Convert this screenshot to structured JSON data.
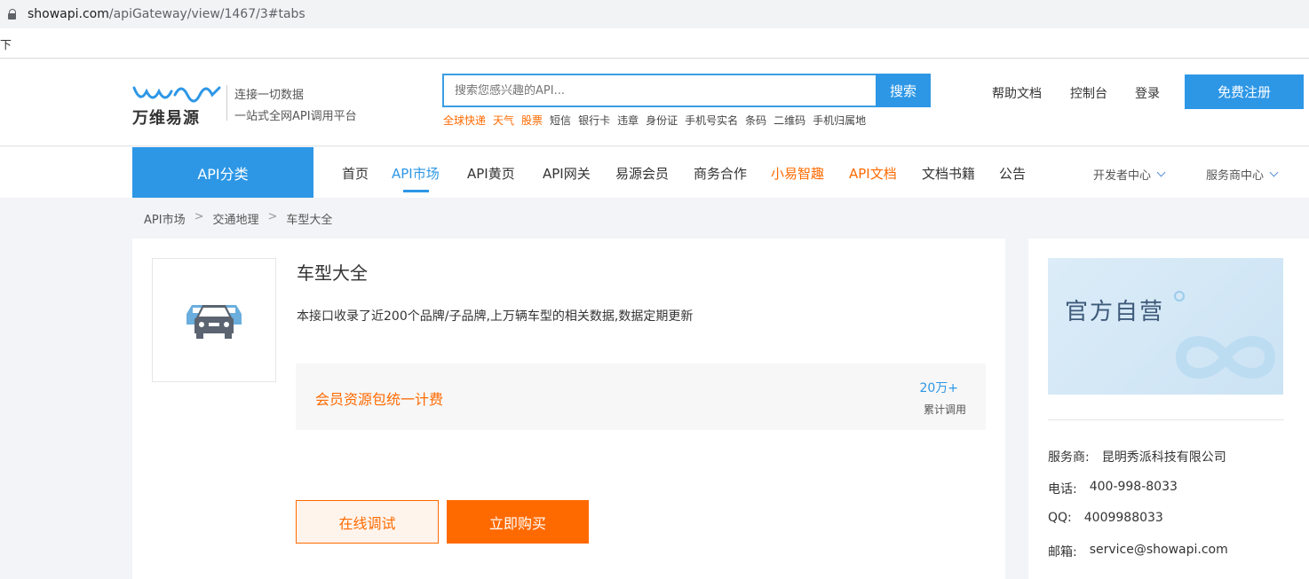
{
  "browser": {
    "url_host": "showapi.com",
    "url_path": "/apiGateway/view/1467/3#tabs",
    "bookmark_fragment": "下"
  },
  "header": {
    "logo_text": "万维易源",
    "slogan_line1": "连接一切数据",
    "slogan_line2": "一站式全网API调用平台",
    "search_placeholder": "搜索您感兴趣的API...",
    "search_button": "搜索",
    "hot_words": [
      {
        "label": "全球快递",
        "hot": true
      },
      {
        "label": "天气",
        "hot": true
      },
      {
        "label": "股票",
        "hot": true
      },
      {
        "label": "短信",
        "hot": false
      },
      {
        "label": "银行卡",
        "hot": false
      },
      {
        "label": "违章",
        "hot": false
      },
      {
        "label": "身份证",
        "hot": false
      },
      {
        "label": "手机号实名",
        "hot": false
      },
      {
        "label": "条码",
        "hot": false
      },
      {
        "label": "二维码",
        "hot": false
      },
      {
        "label": "手机归属地",
        "hot": false
      }
    ],
    "help_docs": "帮助文档",
    "console": "控制台",
    "login": "登录",
    "register": "免费注册"
  },
  "nav": {
    "category": "API分类",
    "items": [
      {
        "label": "首页"
      },
      {
        "label": "API市场"
      },
      {
        "label": "API黄页"
      },
      {
        "label": "API网关"
      },
      {
        "label": "易源会员"
      },
      {
        "label": "商务合作"
      },
      {
        "label": "小易智趣"
      },
      {
        "label": "API文档"
      },
      {
        "label": "文档书籍"
      },
      {
        "label": "公告"
      }
    ],
    "dev_center": "开发者中心",
    "provider_center": "服务商中心"
  },
  "breadcrumb": {
    "items": [
      "API市场",
      "交通地理",
      "车型大全"
    ],
    "separator": ">"
  },
  "api": {
    "title": "车型大全",
    "description": "本接口收录了近200个品牌/子品牌,上万辆车型的相关数据,数据定期更新",
    "pricing": "会员资源包统一计费",
    "calls_count": "20万+",
    "calls_label": "累计调用",
    "btn_test": "在线调试",
    "btn_buy": "立即购买"
  },
  "provider": {
    "banner_text": "官方自营",
    "name_label": "服务商:",
    "name_value": "昆明秀派科技有限公司",
    "phone_label": "电话:",
    "phone_value": "400-998-8033",
    "qq_label": "QQ:",
    "qq_value": "4009988033",
    "email_label": "邮箱:",
    "email_value": "service@showapi.com"
  },
  "colors": {
    "primary_blue": "#2d97e6",
    "accent_orange": "#ff6a00"
  }
}
